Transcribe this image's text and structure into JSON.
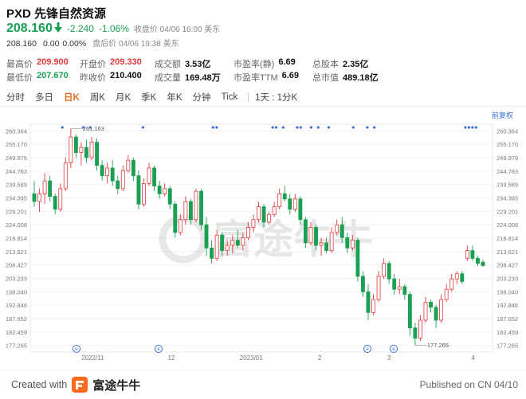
{
  "header": {
    "title": "PXD 先锋自然资源",
    "price": "208.160",
    "change": "-2.240",
    "change_pct": "-1.06%",
    "close_status": "收盘价 04/06 16:00 美东",
    "after_price": "208.160",
    "after_change": "0.00",
    "after_pct": "0.00%",
    "after_status": "盘后价 04/06 19:38 美东"
  },
  "stats": {
    "row1": [
      {
        "label": "最高价",
        "value": "209.900",
        "color": "red"
      },
      {
        "label": "开盘价",
        "value": "209.330",
        "color": "red"
      },
      {
        "label": "成交额",
        "value": "3.53亿",
        "color": "black"
      },
      {
        "label": "市盈率(静)",
        "value": "6.69",
        "color": "black"
      },
      {
        "label": "总股本",
        "value": "2.35亿",
        "color": "black"
      }
    ],
    "row2": [
      {
        "label": "最低价",
        "value": "207.670",
        "color": "green"
      },
      {
        "label": "昨收价",
        "value": "210.400",
        "color": "black"
      },
      {
        "label": "成交量",
        "value": "169.48万",
        "color": "black"
      },
      {
        "label": "市盈率TTM",
        "value": "6.69",
        "color": "black"
      },
      {
        "label": "总市值",
        "value": "489.18亿",
        "color": "black"
      }
    ]
  },
  "tabs": [
    "分时",
    "多日",
    "日K",
    "周K",
    "月K",
    "季K",
    "年K",
    "分钟",
    "Tick"
  ],
  "active_tab": "日K",
  "period_selector": "1天 : 1分K",
  "adjust_label": "前复权",
  "footer": {
    "created_with": "Created with",
    "brand": "富途牛牛",
    "published": "Published on CN 04/10"
  },
  "colors": {
    "up": "#e03a3a",
    "down": "#1aa053",
    "accent": "#e86b1f",
    "marker": "#3a6fd8"
  },
  "chart_data": {
    "type": "candlestick",
    "y_ticks": [
      "260.364",
      "255.170",
      "249.976",
      "244.783",
      "239.589",
      "234.395",
      "229.201",
      "224.008",
      "218.814",
      "213.621",
      "208.427",
      "203.233",
      "192.846",
      "198.040",
      "187.652",
      "182.459",
      "177.265"
    ],
    "ylim": [
      174.668,
      262.961
    ],
    "x_labels": [
      "2022/11",
      "12",
      "2023/01",
      "2",
      "3",
      "4"
    ],
    "annotations": [
      {
        "text": "261.163",
        "type": "high"
      },
      {
        "text": "177.265",
        "type": "low"
      }
    ],
    "watermark": "富途牛牛",
    "ohlc": [
      [
        236.0,
        241.0,
        231.0,
        233.0
      ],
      [
        233.0,
        238.0,
        229.0,
        236.0
      ],
      [
        236.0,
        244.0,
        232.0,
        241.0
      ],
      [
        241.0,
        243.0,
        233.0,
        235.0
      ],
      [
        235.0,
        236.0,
        228.0,
        230.0
      ],
      [
        230.0,
        240.0,
        229.0,
        238.0
      ],
      [
        238.0,
        250.0,
        237.0,
        248.0
      ],
      [
        248.0,
        261.2,
        246.0,
        258.0
      ],
      [
        258.0,
        259.0,
        250.0,
        252.0
      ],
      [
        252.0,
        256.0,
        247.0,
        254.0
      ],
      [
        254.0,
        257.0,
        248.0,
        250.0
      ],
      [
        250.0,
        258.0,
        249.0,
        256.0
      ],
      [
        256.0,
        257.5,
        245.0,
        247.0
      ],
      [
        247.0,
        249.0,
        241.0,
        243.0
      ],
      [
        243.0,
        248.0,
        240.0,
        246.0
      ],
      [
        246.0,
        249.0,
        239.0,
        241.0
      ],
      [
        241.0,
        243.0,
        236.0,
        238.0
      ],
      [
        238.0,
        247.0,
        237.0,
        245.0
      ],
      [
        245.0,
        251.0,
        244.0,
        249.0
      ],
      [
        249.0,
        250.0,
        241.0,
        243.0
      ],
      [
        243.0,
        245.0,
        230.0,
        232.0
      ],
      [
        232.0,
        242.0,
        231.0,
        240.0
      ],
      [
        240.0,
        248.0,
        239.0,
        246.0
      ],
      [
        246.0,
        247.0,
        237.0,
        239.0
      ],
      [
        239.0,
        241.0,
        234.0,
        236.0
      ],
      [
        236.0,
        240.0,
        235.0,
        238.0
      ],
      [
        238.0,
        239.0,
        230.0,
        232.0
      ],
      [
        232.0,
        233.0,
        219.0,
        221.0
      ],
      [
        221.0,
        228.0,
        220.0,
        226.0
      ],
      [
        226.0,
        235.0,
        224.0,
        233.0
      ],
      [
        233.0,
        234.0,
        224.0,
        226.0
      ],
      [
        226.0,
        238.0,
        225.0,
        237.0
      ],
      [
        237.0,
        238.0,
        222.0,
        224.0
      ],
      [
        224.0,
        227.0,
        212.0,
        215.0
      ],
      [
        215.0,
        218.0,
        209.0,
        211.0
      ],
      [
        211.0,
        222.0,
        210.0,
        220.0
      ],
      [
        220.0,
        221.0,
        212.0,
        214.0
      ],
      [
        214.0,
        218.0,
        212.0,
        216.0
      ],
      [
        216.0,
        220.0,
        213.0,
        218.0
      ],
      [
        218.0,
        222.0,
        215.0,
        216.0
      ],
      [
        216.0,
        221.0,
        214.0,
        219.0
      ],
      [
        219.0,
        225.0,
        218.0,
        223.0
      ],
      [
        223.0,
        228.0,
        221.0,
        226.0
      ],
      [
        226.0,
        233.0,
        225.0,
        231.0
      ],
      [
        231.0,
        232.0,
        223.0,
        225.0
      ],
      [
        225.0,
        229.0,
        224.0,
        228.0
      ],
      [
        228.0,
        233.0,
        227.0,
        231.0
      ],
      [
        231.0,
        238.0,
        230.0,
        236.0
      ],
      [
        236.0,
        239.0,
        233.0,
        234.0
      ],
      [
        234.0,
        236.0,
        228.0,
        230.0
      ],
      [
        230.0,
        236.0,
        229.0,
        234.0
      ],
      [
        234.0,
        235.0,
        224.0,
        226.0
      ],
      [
        226.0,
        227.0,
        215.0,
        217.0
      ],
      [
        217.0,
        225.0,
        216.0,
        223.0
      ],
      [
        223.0,
        224.0,
        214.0,
        216.0
      ],
      [
        216.0,
        219.0,
        212.0,
        217.0
      ],
      [
        217.0,
        219.0,
        213.0,
        214.0
      ],
      [
        214.0,
        223.0,
        213.0,
        221.0
      ],
      [
        221.0,
        226.0,
        220.0,
        224.0
      ],
      [
        224.0,
        227.0,
        217.0,
        219.0
      ],
      [
        219.0,
        221.0,
        213.0,
        215.0
      ],
      [
        215.0,
        220.0,
        214.0,
        218.0
      ],
      [
        218.0,
        219.0,
        202.0,
        204.0
      ],
      [
        204.0,
        206.0,
        196.0,
        198.0
      ],
      [
        198.0,
        201.0,
        187.0,
        190.0
      ],
      [
        190.0,
        197.0,
        189.0,
        195.0
      ],
      [
        195.0,
        206.0,
        194.0,
        204.0
      ],
      [
        204.0,
        211.0,
        203.0,
        209.0
      ],
      [
        209.0,
        210.0,
        201.0,
        203.0
      ],
      [
        203.0,
        205.0,
        197.0,
        199.0
      ],
      [
        199.0,
        203.0,
        197.0,
        200.0
      ],
      [
        200.0,
        201.0,
        195.0,
        197.0
      ],
      [
        197.0,
        198.0,
        181.0,
        184.0
      ],
      [
        184.0,
        186.0,
        177.3,
        180.0
      ],
      [
        180.0,
        189.0,
        179.0,
        187.0
      ],
      [
        187.0,
        196.0,
        186.0,
        194.0
      ],
      [
        194.0,
        195.0,
        190.0,
        192.0
      ],
      [
        192.0,
        193.0,
        184.0,
        187.0
      ],
      [
        187.0,
        197.0,
        186.0,
        195.0
      ],
      [
        195.0,
        201.0,
        194.0,
        199.0
      ],
      [
        199.0,
        205.0,
        198.0,
        203.0
      ],
      [
        203.0,
        206.0,
        201.0,
        205.0
      ],
      [
        205.0,
        206.0,
        201.0,
        202.0
      ],
      [
        211.0,
        216.0,
        210.0,
        214.0
      ],
      [
        214.0,
        216.0,
        210.0,
        211.0
      ],
      [
        211.0,
        212.0,
        208.0,
        209.0
      ],
      [
        209.5,
        210.4,
        207.7,
        208.2
      ]
    ],
    "event_markers": [
      8,
      14,
      16,
      31,
      51,
      52,
      68,
      69,
      71,
      75,
      76,
      79,
      81,
      84,
      91,
      95,
      97,
      123,
      124,
      125,
      126
    ],
    "bottom_markers": [
      "e",
      "e",
      "e",
      "e"
    ]
  }
}
